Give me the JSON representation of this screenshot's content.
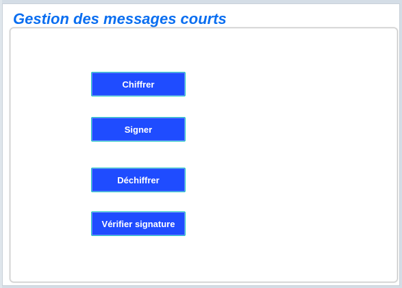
{
  "header": {
    "title": "Gestion des messages courts"
  },
  "actions": {
    "encrypt_label": "Chiffrer",
    "sign_label": "Signer",
    "decrypt_label": "Déchiffrer",
    "verify_label": "Vérifier signature"
  },
  "colors": {
    "title": "#0a6ef0",
    "button_bg": "#1f4cff",
    "button_border": "#1ec9c0",
    "button_text": "#ffffff"
  }
}
